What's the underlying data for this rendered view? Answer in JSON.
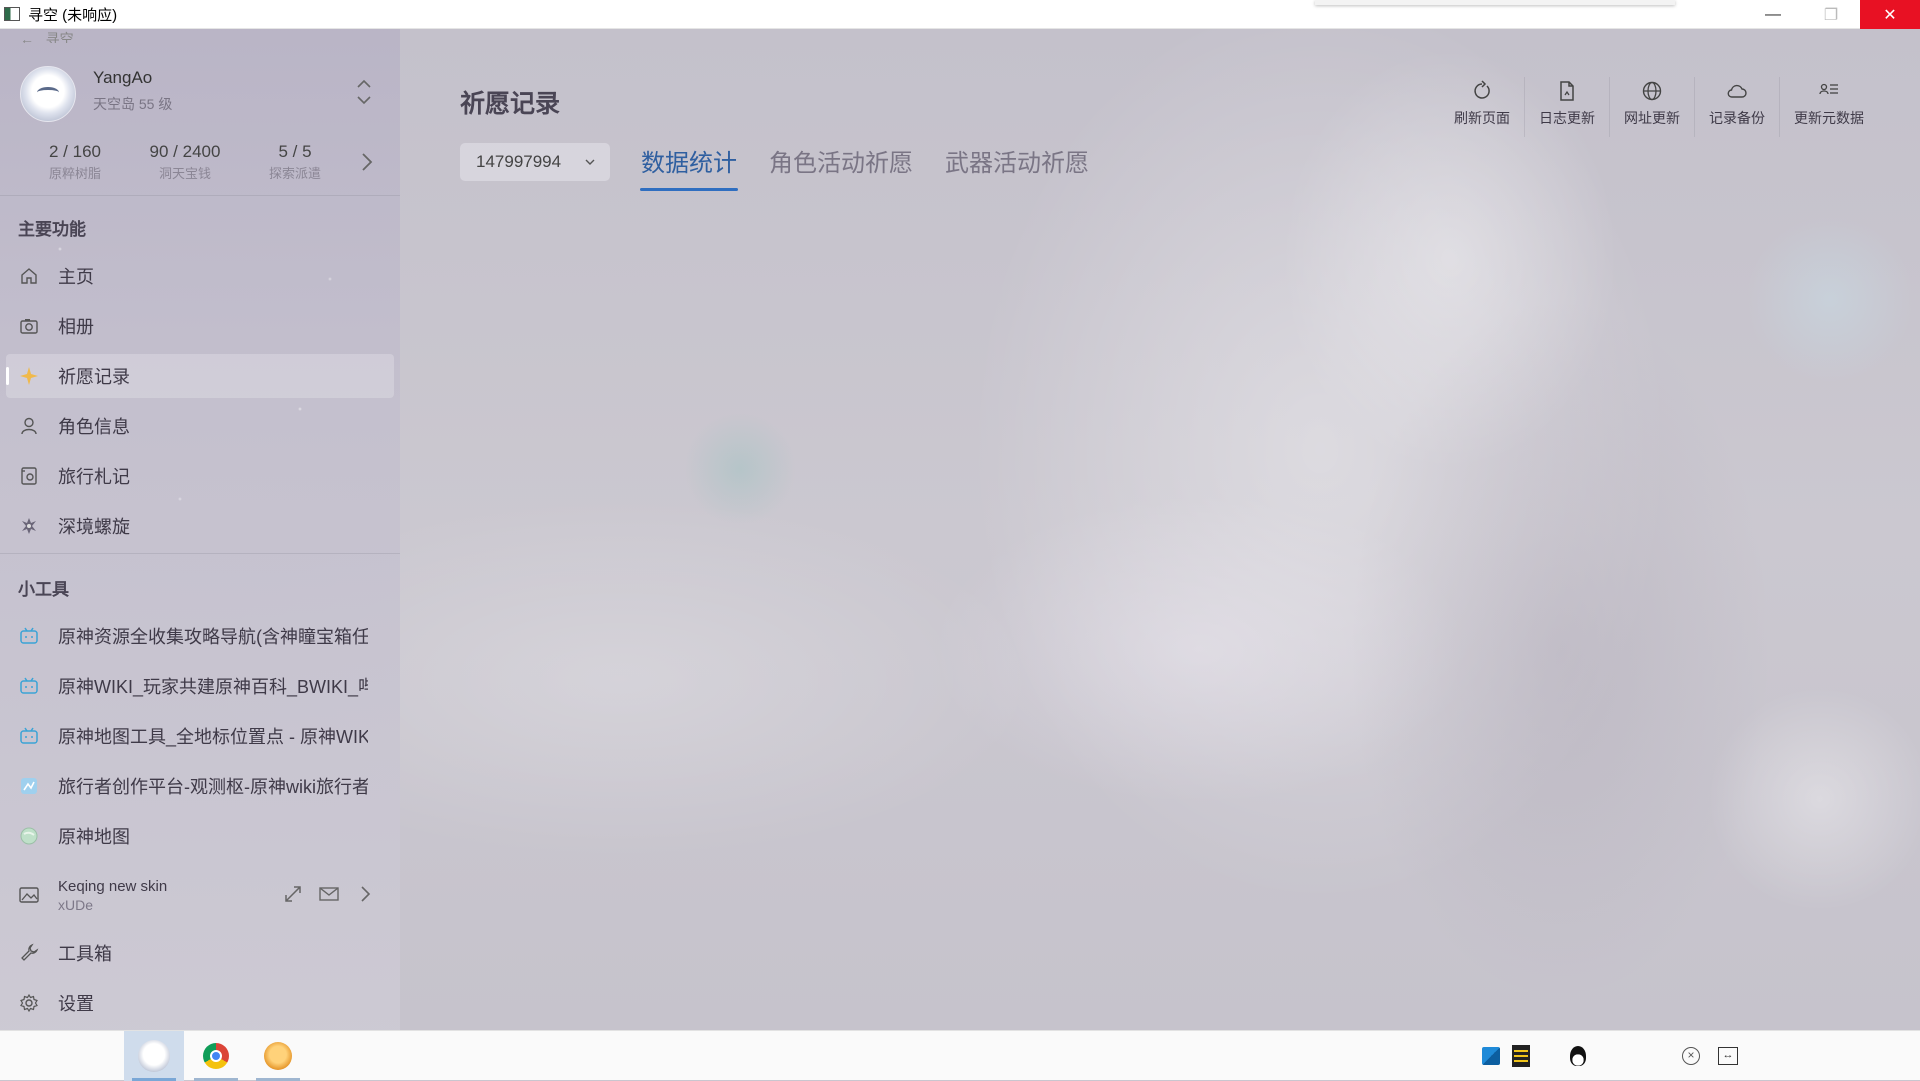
{
  "window": {
    "title": "寻空 (未响应)",
    "controls": {
      "minimize": "—",
      "restore": "❐",
      "close": "✕"
    }
  },
  "sidebar": {
    "back_label": "寻空",
    "profile": {
      "name": "YangAo",
      "server_level": "天空岛   55 级"
    },
    "stats": [
      {
        "value": "2 / 160",
        "label": "原粹树脂"
      },
      {
        "value": "90 / 2400",
        "label": "洞天宝钱"
      },
      {
        "value": "5 / 5",
        "label": "探索派遣"
      }
    ],
    "main_section": "主要功能",
    "main_items": [
      {
        "label": "主页",
        "icon": "home-icon"
      },
      {
        "label": "相册",
        "icon": "camera-icon"
      },
      {
        "label": "祈愿记录",
        "icon": "sparkle-icon",
        "active": true
      },
      {
        "label": "角色信息",
        "icon": "person-icon"
      },
      {
        "label": "旅行札记",
        "icon": "notebook-icon"
      },
      {
        "label": "深境螺旋",
        "icon": "spiral-icon"
      }
    ],
    "tools_section": "小工具",
    "tool_items": [
      {
        "label": "原神资源全收集攻略导航(含神瞳宝箱任务",
        "icon": "bilibili-icon"
      },
      {
        "label": "原神WIKI_玩家共建原神百科_BWIKI_哔哩",
        "icon": "bilibili-icon"
      },
      {
        "label": "原神地图工具_全地标位置点 - 原神WIKI_",
        "icon": "bilibili-icon"
      },
      {
        "label": "旅行者创作平台-观测枢-原神wiki旅行者",
        "icon": "observatory-icon"
      },
      {
        "label": "原神地图",
        "icon": "map-globe-icon"
      }
    ],
    "wallpaper": {
      "title": "Keqing new skin",
      "author": "xUDe"
    },
    "bottom_items": [
      {
        "label": "工具箱",
        "icon": "wrench-icon"
      },
      {
        "label": "设置",
        "icon": "gear-icon"
      }
    ]
  },
  "main": {
    "page_title": "祈愿记录",
    "uid": "147997994",
    "tabs": [
      "数据统计",
      "角色活动祈愿",
      "武器活动祈愿"
    ],
    "active_tab": 0,
    "toolbar": [
      {
        "label": "刷新页面",
        "icon": "refresh-icon"
      },
      {
        "label": "日志更新",
        "icon": "document-icon"
      },
      {
        "label": "网址更新",
        "icon": "globe-icon"
      },
      {
        "label": "记录备份",
        "icon": "cloud-icon"
      },
      {
        "label": "更新元数据",
        "icon": "metadata-icon"
      }
    ]
  },
  "taskbar": {
    "apps": [
      {
        "name": "xunkong-app-icon",
        "active": true
      },
      {
        "name": "chrome-icon",
        "active": false
      },
      {
        "name": "genshin-app-icon",
        "active": false
      }
    ],
    "tray": [
      "defender-icon",
      "film-icon",
      "qq-icon",
      "close-circle-icon",
      "resize-icon"
    ]
  },
  "colors": {
    "accent": "#2f6ec0",
    "close_button": "#e81123",
    "taskbar_active": "#cfdcec"
  }
}
